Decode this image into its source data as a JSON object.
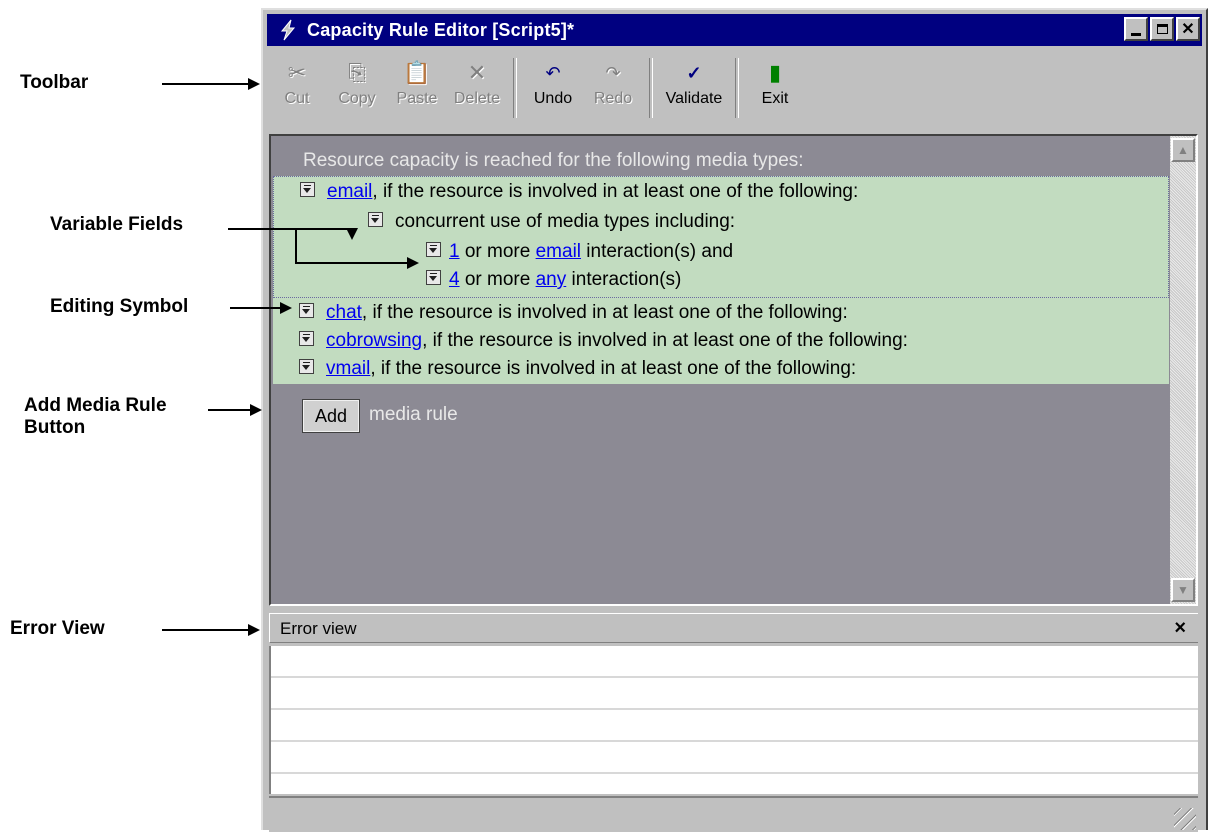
{
  "callouts": {
    "toolbar": "Toolbar",
    "variable_fields": "Variable Fields",
    "editing_symbol": "Editing Symbol",
    "add_media_rule_button": [
      "Add Media Rule",
      "Button"
    ],
    "error_view": "Error View"
  },
  "window": {
    "title": "Capacity Rule Editor [Script5]*",
    "app_icon": "lightning-icon",
    "title_buttons": [
      "minimize",
      "maximize",
      "close"
    ]
  },
  "toolbar": {
    "items": [
      {
        "label": "Cut",
        "icon": "scissors-icon",
        "enabled": false
      },
      {
        "label": "Copy",
        "icon": "copy-icon",
        "enabled": false
      },
      {
        "label": "Paste",
        "icon": "paste-icon",
        "enabled": false
      },
      {
        "label": "Delete",
        "icon": "delete-x-icon",
        "enabled": false
      },
      {
        "label": "Undo",
        "icon": "undo-icon",
        "enabled": true
      },
      {
        "label": "Redo",
        "icon": "redo-icon",
        "enabled": false
      },
      {
        "label": "Validate",
        "icon": "spellcheck-icon",
        "enabled": true
      },
      {
        "label": "Exit",
        "icon": "exit-door-icon",
        "enabled": true
      }
    ]
  },
  "editor": {
    "header": "Resource capacity is reached for the following media types:",
    "rules": [
      {
        "media": "email",
        "suffix": ", if the resource is involved in at least one of the following:"
      },
      {
        "media": "chat",
        "suffix": ", if the resource is involved in at least one of the following:"
      },
      {
        "media": "cobrowsing",
        "suffix": ", if the resource is involved in at least one of the following:"
      },
      {
        "media": "vmail",
        "suffix": ", if the resource is involved in at least one of the following:"
      }
    ],
    "concurrent": "concurrent use of media types including:",
    "conditions": [
      {
        "count": "1",
        "mid": " or more ",
        "media": "email",
        "tail": " interaction(s) and"
      },
      {
        "count": "4",
        "mid": " or more ",
        "media": "any",
        "tail": " interaction(s)"
      }
    ],
    "add_button": "Add",
    "add_label": "media rule"
  },
  "error_view": {
    "title": "Error view",
    "close": "×"
  },
  "colors": {
    "titlebar": "#000080",
    "editor_bg": "#8c8a94",
    "rule_bg": "#c2dcc0",
    "link": "#0000ee"
  }
}
